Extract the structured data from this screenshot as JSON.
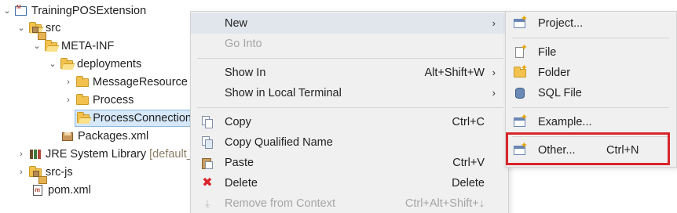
{
  "tree": {
    "items": [
      {
        "label": "TrainingPOSExtension"
      },
      {
        "label": "src"
      },
      {
        "label": "META-INF"
      },
      {
        "label": "deployments"
      },
      {
        "label": "MessageResource"
      },
      {
        "label": "Process"
      },
      {
        "label": "ProcessConnection"
      },
      {
        "label": "Packages.xml"
      },
      {
        "label": "JRE System Library",
        "suffix": "[default_"
      },
      {
        "label": "src-js"
      },
      {
        "label": "pom.xml"
      }
    ]
  },
  "context_menu": {
    "items": [
      {
        "label": "New",
        "shortcut": "",
        "has_submenu": true
      },
      {
        "label": "Go Into",
        "shortcut": "",
        "disabled": true
      },
      {
        "label": "Show In",
        "shortcut": "Alt+Shift+W",
        "has_submenu": true
      },
      {
        "label": "Show in Local Terminal",
        "shortcut": "",
        "has_submenu": true
      },
      {
        "label": "Copy",
        "shortcut": "Ctrl+C"
      },
      {
        "label": "Copy Qualified Name",
        "shortcut": ""
      },
      {
        "label": "Paste",
        "shortcut": "Ctrl+V"
      },
      {
        "label": "Delete",
        "shortcut": "Delete"
      },
      {
        "label": "Remove from Context",
        "shortcut": "Ctrl+Alt+Shift+↓",
        "disabled": true
      }
    ],
    "arrow": "›"
  },
  "submenu": {
    "items": [
      {
        "label": "Project...",
        "shortcut": ""
      },
      {
        "label": "File",
        "shortcut": ""
      },
      {
        "label": "Folder",
        "shortcut": ""
      },
      {
        "label": "SQL File",
        "shortcut": ""
      },
      {
        "label": "Example...",
        "shortcut": ""
      },
      {
        "label": "Other...",
        "shortcut": "Ctrl+N"
      }
    ]
  },
  "colors": {
    "highlight_box": "#d9252a",
    "selection_bg": "#d6e8f9",
    "menu_bg": "#f0f0f0",
    "hover_bg": "#e1e6ec"
  }
}
